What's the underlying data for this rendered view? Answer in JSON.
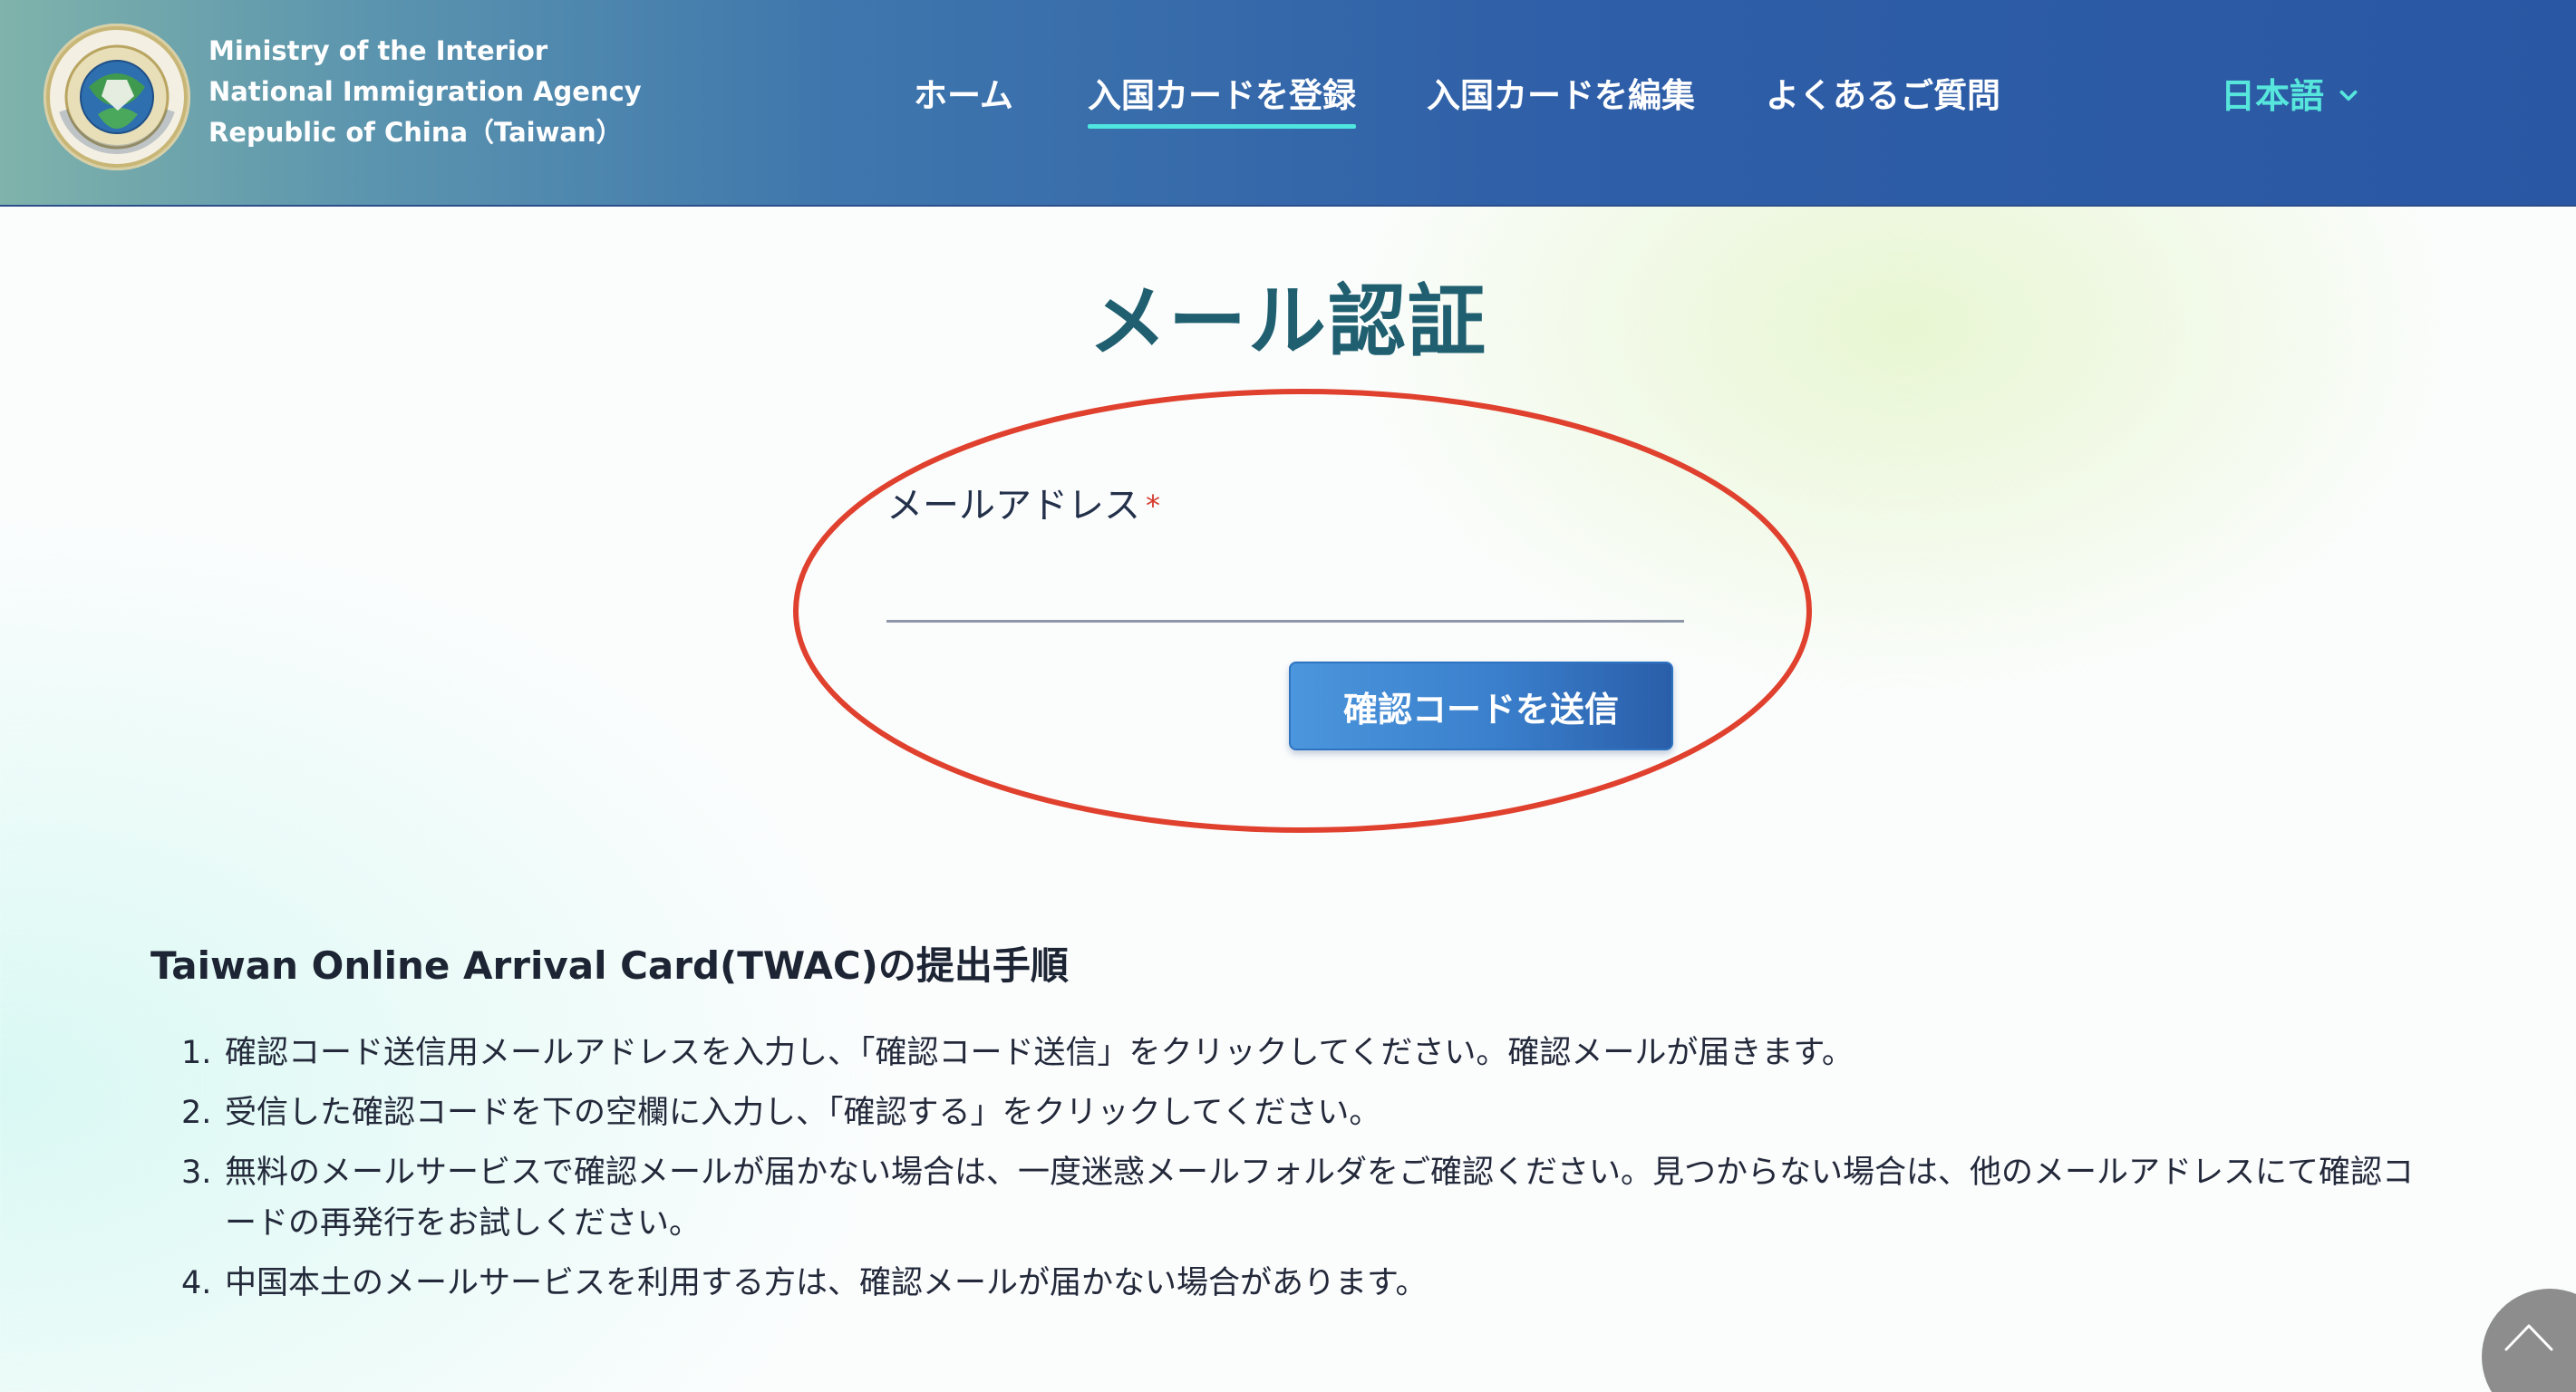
{
  "header": {
    "org_lines": [
      "Ministry of the Interior",
      "National Immigration Agency",
      "Republic of China（Taiwan）"
    ],
    "logo_icon": "nia-seal-icon",
    "nav": [
      {
        "label": "ホーム",
        "active": false
      },
      {
        "label": "入国カードを登録",
        "active": true
      },
      {
        "label": "入国カードを編集",
        "active": false
      },
      {
        "label": "よくあるご質問",
        "active": false
      }
    ],
    "language": "日本語",
    "active_underline_color": "#4fe6e0",
    "language_color": "#57e6dc"
  },
  "main": {
    "title": "メール認証",
    "email_label": "メールアドレス",
    "required_mark": "*",
    "email_value": "",
    "send_button_label": "確認コードを送信",
    "highlight_color": "#e0412e"
  },
  "instructions": {
    "title": "Taiwan Online Arrival Card(TWAC)の提出手順",
    "steps": [
      {
        "num": "1.",
        "text": "確認コード送信用メールアドレスを入力し、「確認コード送信」をクリックしてください。確認メールが届きます。"
      },
      {
        "num": "2.",
        "text": "受信した確認コードを下の空欄に入力し、「確認する」をクリックしてください。"
      },
      {
        "num": "3.",
        "text": "無料のメールサービスで確認メールが届かない場合は、一度迷惑メールフォルダをご確認ください。見つからない場合は、他のメールアドレスにて確認コードの再発行をお試しください。"
      },
      {
        "num": "4.",
        "text": "中国本土のメールサービスを利用する方は、確認メールが届かない場合があります。"
      }
    ]
  },
  "scroll_top": {
    "icon": "chevron-up-icon"
  }
}
